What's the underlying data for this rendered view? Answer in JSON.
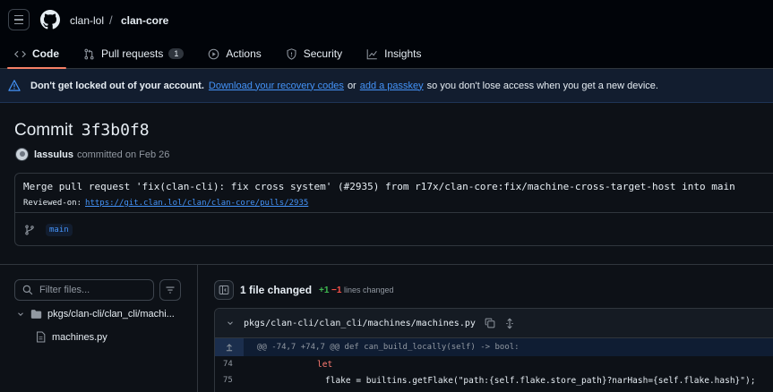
{
  "header": {
    "owner": "clan-lol",
    "separator": "/",
    "repo": "clan-core"
  },
  "tabs": [
    {
      "label": "Code",
      "icon": "code-icon",
      "active": true
    },
    {
      "label": "Pull requests",
      "icon": "git-pull-request-icon",
      "count": "1"
    },
    {
      "label": "Actions",
      "icon": "play-icon"
    },
    {
      "label": "Security",
      "icon": "shield-icon"
    },
    {
      "label": "Insights",
      "icon": "graph-icon"
    }
  ],
  "banner": {
    "bold": "Don't get locked out of your account.",
    "link1": "Download your recovery codes",
    "mid": "or",
    "link2": "add a passkey",
    "tail": "so you don't lose access when you get a new device."
  },
  "commit": {
    "title": "Commit",
    "sha": "3f3b0f8",
    "author": "lassulus",
    "committed": "committed on Feb 26",
    "message": "Merge pull request 'fix(clan-cli): fix cross system' (#2935) from r17x/clan-core:fix/machine-cross-target-host into main",
    "reviewed_label": "Reviewed-on:",
    "reviewed_url": "https://git.clan.lol/clan/clan-core/pulls/2935",
    "branch": "main"
  },
  "file_tree": {
    "filter_placeholder": "Filter files...",
    "directory": "pkgs/clan-cli/clan_cli/machi...",
    "file": "machines.py"
  },
  "diff": {
    "files_changed": "1 file changed",
    "additions": "+1",
    "deletions": "−1",
    "lines_changed": "lines changed",
    "path": "pkgs/clan-cli/clan_cli/machines/machines.py",
    "hunk": "@@ -74,7 +74,7 @@ def can_build_locally(self) -> bool:",
    "lines": [
      {
        "num": "74",
        "code": "let"
      },
      {
        "num": "75",
        "code": "flake = builtins.getFlake(\"path:{self.flake.store_path}?narHash={self.flake.hash}\");"
      }
    ]
  },
  "colors": {
    "accent": "#4493f8",
    "tab_underline": "#f78166",
    "addition": "#3fb950",
    "deletion": "#f85149"
  }
}
